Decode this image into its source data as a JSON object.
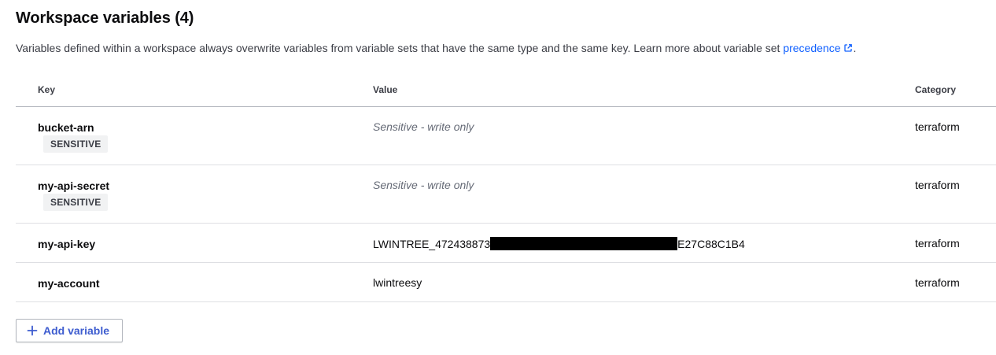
{
  "header": {
    "title": "Workspace variables (4)",
    "description_prefix": "Variables defined within a workspace always overwrite variables from variable sets that have the same type and the same key. Learn more about variable set ",
    "precedence_link": "precedence",
    "description_suffix": "."
  },
  "table": {
    "columns": {
      "key": "Key",
      "value": "Value",
      "category": "Category"
    },
    "rows": [
      {
        "key": "bucket-arn",
        "badge": "SENSITIVE",
        "value": "Sensitive - write only",
        "category": "terraform"
      },
      {
        "key": "my-api-secret",
        "badge": "SENSITIVE",
        "value": "Sensitive - write only",
        "category": "terraform"
      },
      {
        "key": "my-api-key",
        "value_prefix": "LWINTREE_472438873",
        "value_suffix": "E27C88C1B4",
        "category": "terraform"
      },
      {
        "key": "my-account",
        "value": "lwintreesy",
        "category": "terraform"
      }
    ]
  },
  "actions": {
    "add_variable_label": "Add variable"
  },
  "colors": {
    "link": "#1060ff",
    "button_text": "#3d5ccf",
    "badge_bg": "#f1f2f3",
    "redaction": "#000000"
  },
  "icons": {
    "external_link": "external-link-icon",
    "add": "plus-icon"
  }
}
